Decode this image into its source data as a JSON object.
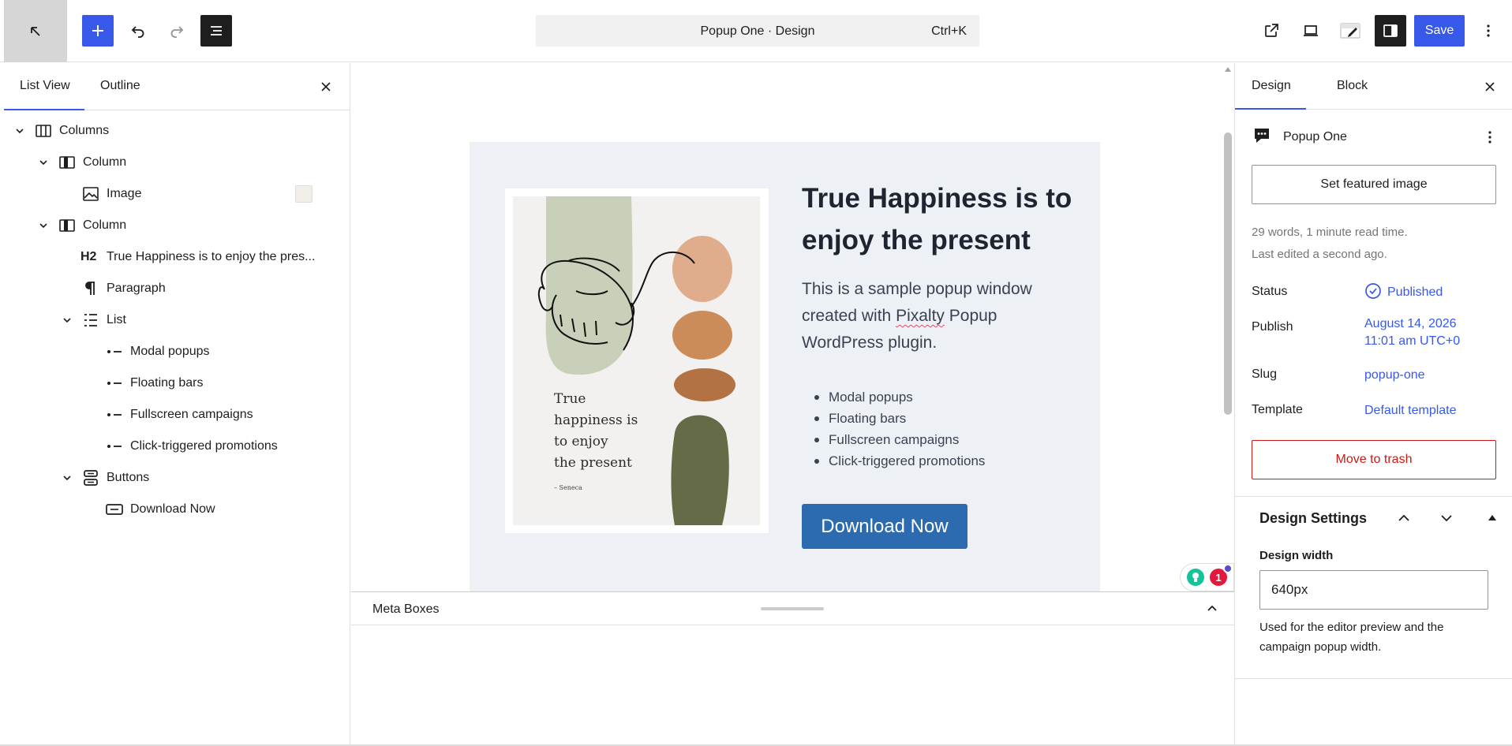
{
  "topbar": {
    "title": "Popup One · Design",
    "shortcut": "Ctrl+K",
    "save_label": "Save"
  },
  "list_view": {
    "tabs": [
      "List View",
      "Outline"
    ],
    "active_tab": "List View",
    "items": [
      {
        "label": "Columns",
        "icon": "columns-icon",
        "expanded": true
      },
      {
        "label": "Column",
        "icon": "column-icon",
        "expanded": true
      },
      {
        "label": "Image",
        "icon": "image-icon"
      },
      {
        "label": "Column",
        "icon": "column-icon",
        "expanded": true
      },
      {
        "label": "True Happiness is to enjoy the pres...",
        "icon": "heading-icon",
        "icon_text": "H2"
      },
      {
        "label": "Paragraph",
        "icon": "paragraph-icon"
      },
      {
        "label": "List",
        "icon": "list-icon",
        "expanded": true
      },
      {
        "label": "Modal popups",
        "icon": "list-item-icon"
      },
      {
        "label": "Floating bars",
        "icon": "list-item-icon"
      },
      {
        "label": "Fullscreen campaigns",
        "icon": "list-item-icon"
      },
      {
        "label": "Click-triggered promotions",
        "icon": "list-item-icon"
      },
      {
        "label": "Buttons",
        "icon": "buttons-icon",
        "expanded": true
      },
      {
        "label": "Download Now",
        "icon": "button-icon"
      }
    ]
  },
  "canvas": {
    "poster": {
      "quote_lines": [
        "True",
        "happiness is",
        "to enjoy",
        "the present"
      ],
      "author": "– Seneca"
    },
    "heading": "True Happiness is to enjoy the present",
    "paragraph_before": "This is a sample popup window created with ",
    "paragraph_link": "Pixalty",
    "paragraph_after": " Popup WordPress plugin.",
    "list": [
      "Modal popups",
      "Floating bars",
      "Fullscreen campaigns",
      "Click-triggered promotions"
    ],
    "button_label": "Download Now",
    "extension_badge_count": "1"
  },
  "meta_boxes": {
    "title": "Meta Boxes"
  },
  "sidebar": {
    "tabs": [
      "Design",
      "Block"
    ],
    "active_tab": "Design",
    "document_title": "Popup One",
    "featured_image_label": "Set featured image",
    "stats": "29 words, 1 minute read time.",
    "last_edited": "Last edited a second ago.",
    "rows": {
      "status": {
        "label": "Status",
        "value": "Published"
      },
      "publish": {
        "label": "Publish",
        "value_line1": "August 14, 2026",
        "value_line2": "11:01 am UTC+0"
      },
      "slug": {
        "label": "Slug",
        "value": "popup-one"
      },
      "template": {
        "label": "Template",
        "value": "Default template"
      }
    },
    "trash_label": "Move to trash",
    "design_settings": {
      "title": "Design Settings",
      "width_label": "Design width",
      "width_value": "640px",
      "help": "Used for the editor preview and the campaign popup width."
    }
  },
  "colors": {
    "accent": "#3858e9",
    "popup_bg": "#edf1f5",
    "cta_button": "#2c6bb0",
    "danger": "#cc1818"
  }
}
